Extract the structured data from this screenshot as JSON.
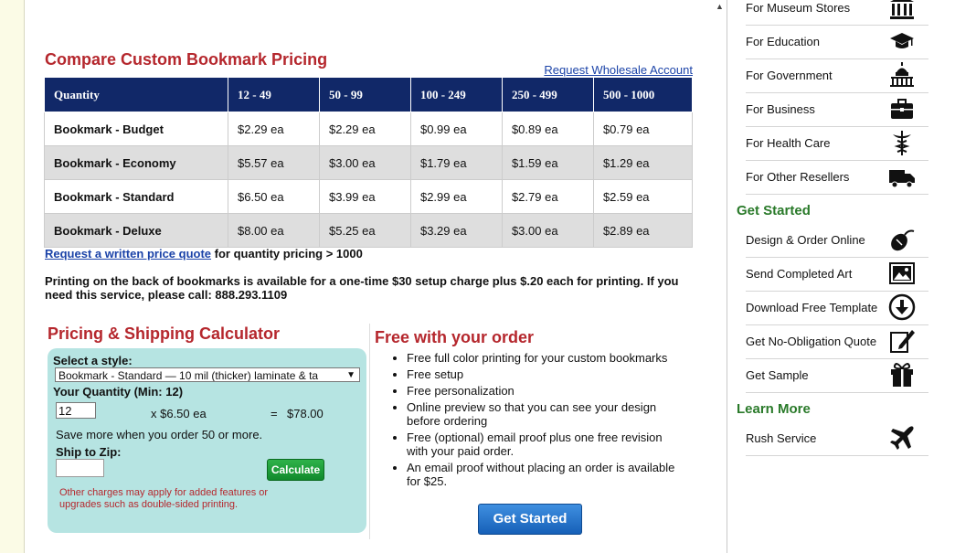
{
  "pricing": {
    "title": "Compare Custom Bookmark Pricing",
    "wholesale_link": "Request Wholesale Account",
    "headers": [
      "Quantity",
      "12 - 49",
      "50 - 99",
      "100 - 249",
      "250 - 499",
      "500 - 1000"
    ],
    "rows": [
      {
        "name": "Bookmark - Budget",
        "prices": [
          "$2.29 ea",
          "$2.29 ea",
          "$0.99 ea",
          "$0.89 ea",
          "$0.79 ea"
        ]
      },
      {
        "name": "Bookmark - Economy",
        "prices": [
          "$5.57 ea",
          "$3.00 ea",
          "$1.79 ea",
          "$1.59 ea",
          "$1.29 ea"
        ]
      },
      {
        "name": "Bookmark - Standard",
        "prices": [
          "$6.50 ea",
          "$3.99 ea",
          "$2.99 ea",
          "$2.79 ea",
          "$2.59 ea"
        ]
      },
      {
        "name": "Bookmark - Deluxe",
        "prices": [
          "$8.00 ea",
          "$5.25 ea",
          "$3.29 ea",
          "$3.00 ea",
          "$2.89 ea"
        ]
      }
    ],
    "quote_link": "Request a written price quote",
    "quote_suffix": " for quantity pricing > 1000",
    "notice": "Printing on the back of bookmarks is available for a one-time $30 setup charge plus $.20 each for printing. If you need this service, please call: 888.293.1109"
  },
  "calculator": {
    "title": "Pricing & Shipping Calculator",
    "style_label": "Select a style:",
    "style_value": "Bookmark - Standard — 10 mil (thicker) laminate & ta",
    "qty_label": "Your Quantity (Min: 12)",
    "qty_value": "12",
    "unit_price": "x $6.50 ea",
    "equals": "=",
    "total": "$78.00",
    "save_note": "Save more when you order 50 or more.",
    "zip_label": "Ship to Zip:",
    "zip_value": "",
    "calculate_label": "Calculate",
    "charges_note": "Other charges may apply for added features or upgrades such as double-sided printing."
  },
  "free": {
    "title": "Free with your order",
    "items": [
      "Free full color printing for your custom bookmarks",
      "Free setup",
      "Free personalization",
      "Online preview so that you can see your design before ordering",
      "Free (optional) email proof plus one free revision with your paid order.",
      "An email proof without placing an order is available for $25."
    ],
    "button": "Get Started"
  },
  "sidebar": {
    "markets": [
      {
        "label": "For Museum Stores",
        "icon": "museum-icon"
      },
      {
        "label": "For Education",
        "icon": "graduation-cap-icon"
      },
      {
        "label": "For Government",
        "icon": "capitol-icon"
      },
      {
        "label": "For Business",
        "icon": "briefcase-icon"
      },
      {
        "label": "For Health Care",
        "icon": "caduceus-icon"
      },
      {
        "label": "For Other Resellers",
        "icon": "truck-icon"
      }
    ],
    "get_started_heading": "Get Started",
    "get_started": [
      {
        "label": "Design & Order Online",
        "icon": "mouse-icon"
      },
      {
        "label": "Send Completed Art",
        "icon": "image-icon"
      },
      {
        "label": "Download Free Template",
        "icon": "download-icon"
      },
      {
        "label": "Get No-Obligation Quote",
        "icon": "edit-icon"
      },
      {
        "label": "Get Sample",
        "icon": "gift-icon"
      }
    ],
    "learn_more_heading": "Learn More",
    "learn_more": [
      {
        "label": "Rush Service",
        "icon": "airplane-icon"
      }
    ]
  }
}
